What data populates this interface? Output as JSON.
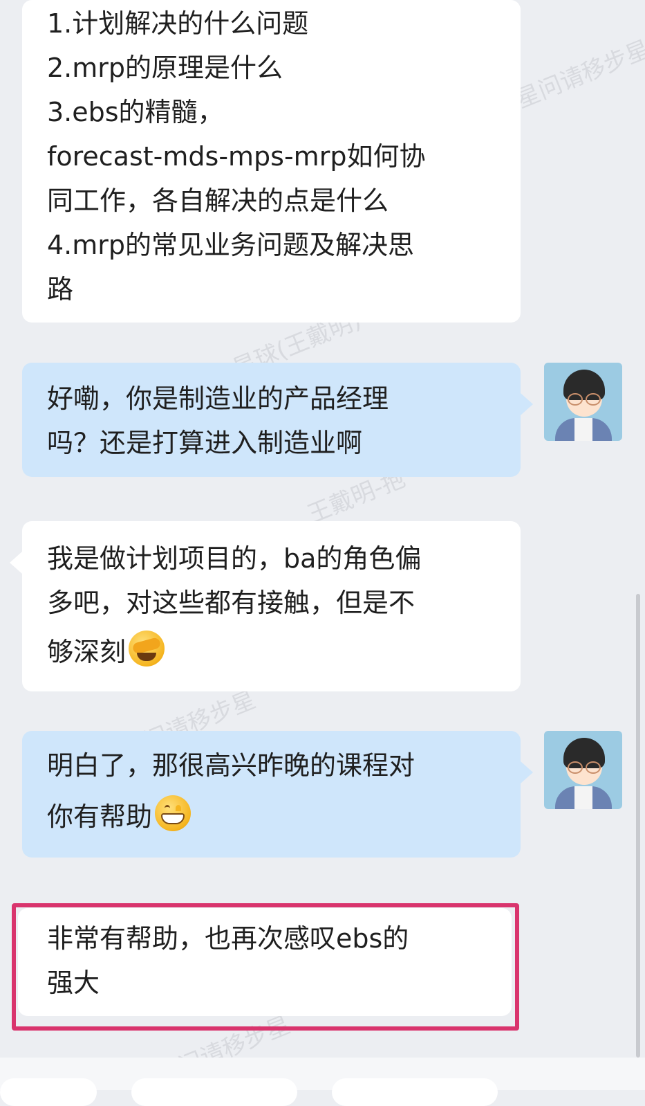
{
  "watermark": {
    "text_a": "星问请移步星",
    "text_b": "星球(王戴明)",
    "text_c": "王戴明-抱"
  },
  "messages": [
    {
      "side": "incoming",
      "lines": [
        "1.计划解决的什么问题",
        "2.mrp的原理是什么",
        "3.ebs的精髓，",
        "forecast-mds-mps-mrp如何协",
        "同工作，各自解决的点是什么",
        "4.mrp的常见业务问题及解决思",
        "路"
      ]
    },
    {
      "side": "outgoing",
      "lines": [
        "好嘞，你是制造业的产品经理",
        "吗？还是打算进入制造业啊"
      ]
    },
    {
      "side": "incoming",
      "lines": [
        "我是做计划项目的，ba的角色偏",
        "多吧，对这些都有接触，但是不",
        "够深刻"
      ],
      "emoji": "facepalm-emoji"
    },
    {
      "side": "outgoing",
      "lines": [
        "明白了，那很高兴昨晚的课程对",
        "你有帮助"
      ],
      "emoji": "grin-emoji"
    },
    {
      "side": "incoming",
      "lines": [
        "非常有帮助，也再次感叹ebs的",
        "强大"
      ],
      "highlight_color": "#d9346d"
    }
  ],
  "colors": {
    "background": "#eceef2",
    "incoming_bubble": "#ffffff",
    "outgoing_bubble": "#cfe6fb",
    "highlight_border": "#d9346d"
  }
}
